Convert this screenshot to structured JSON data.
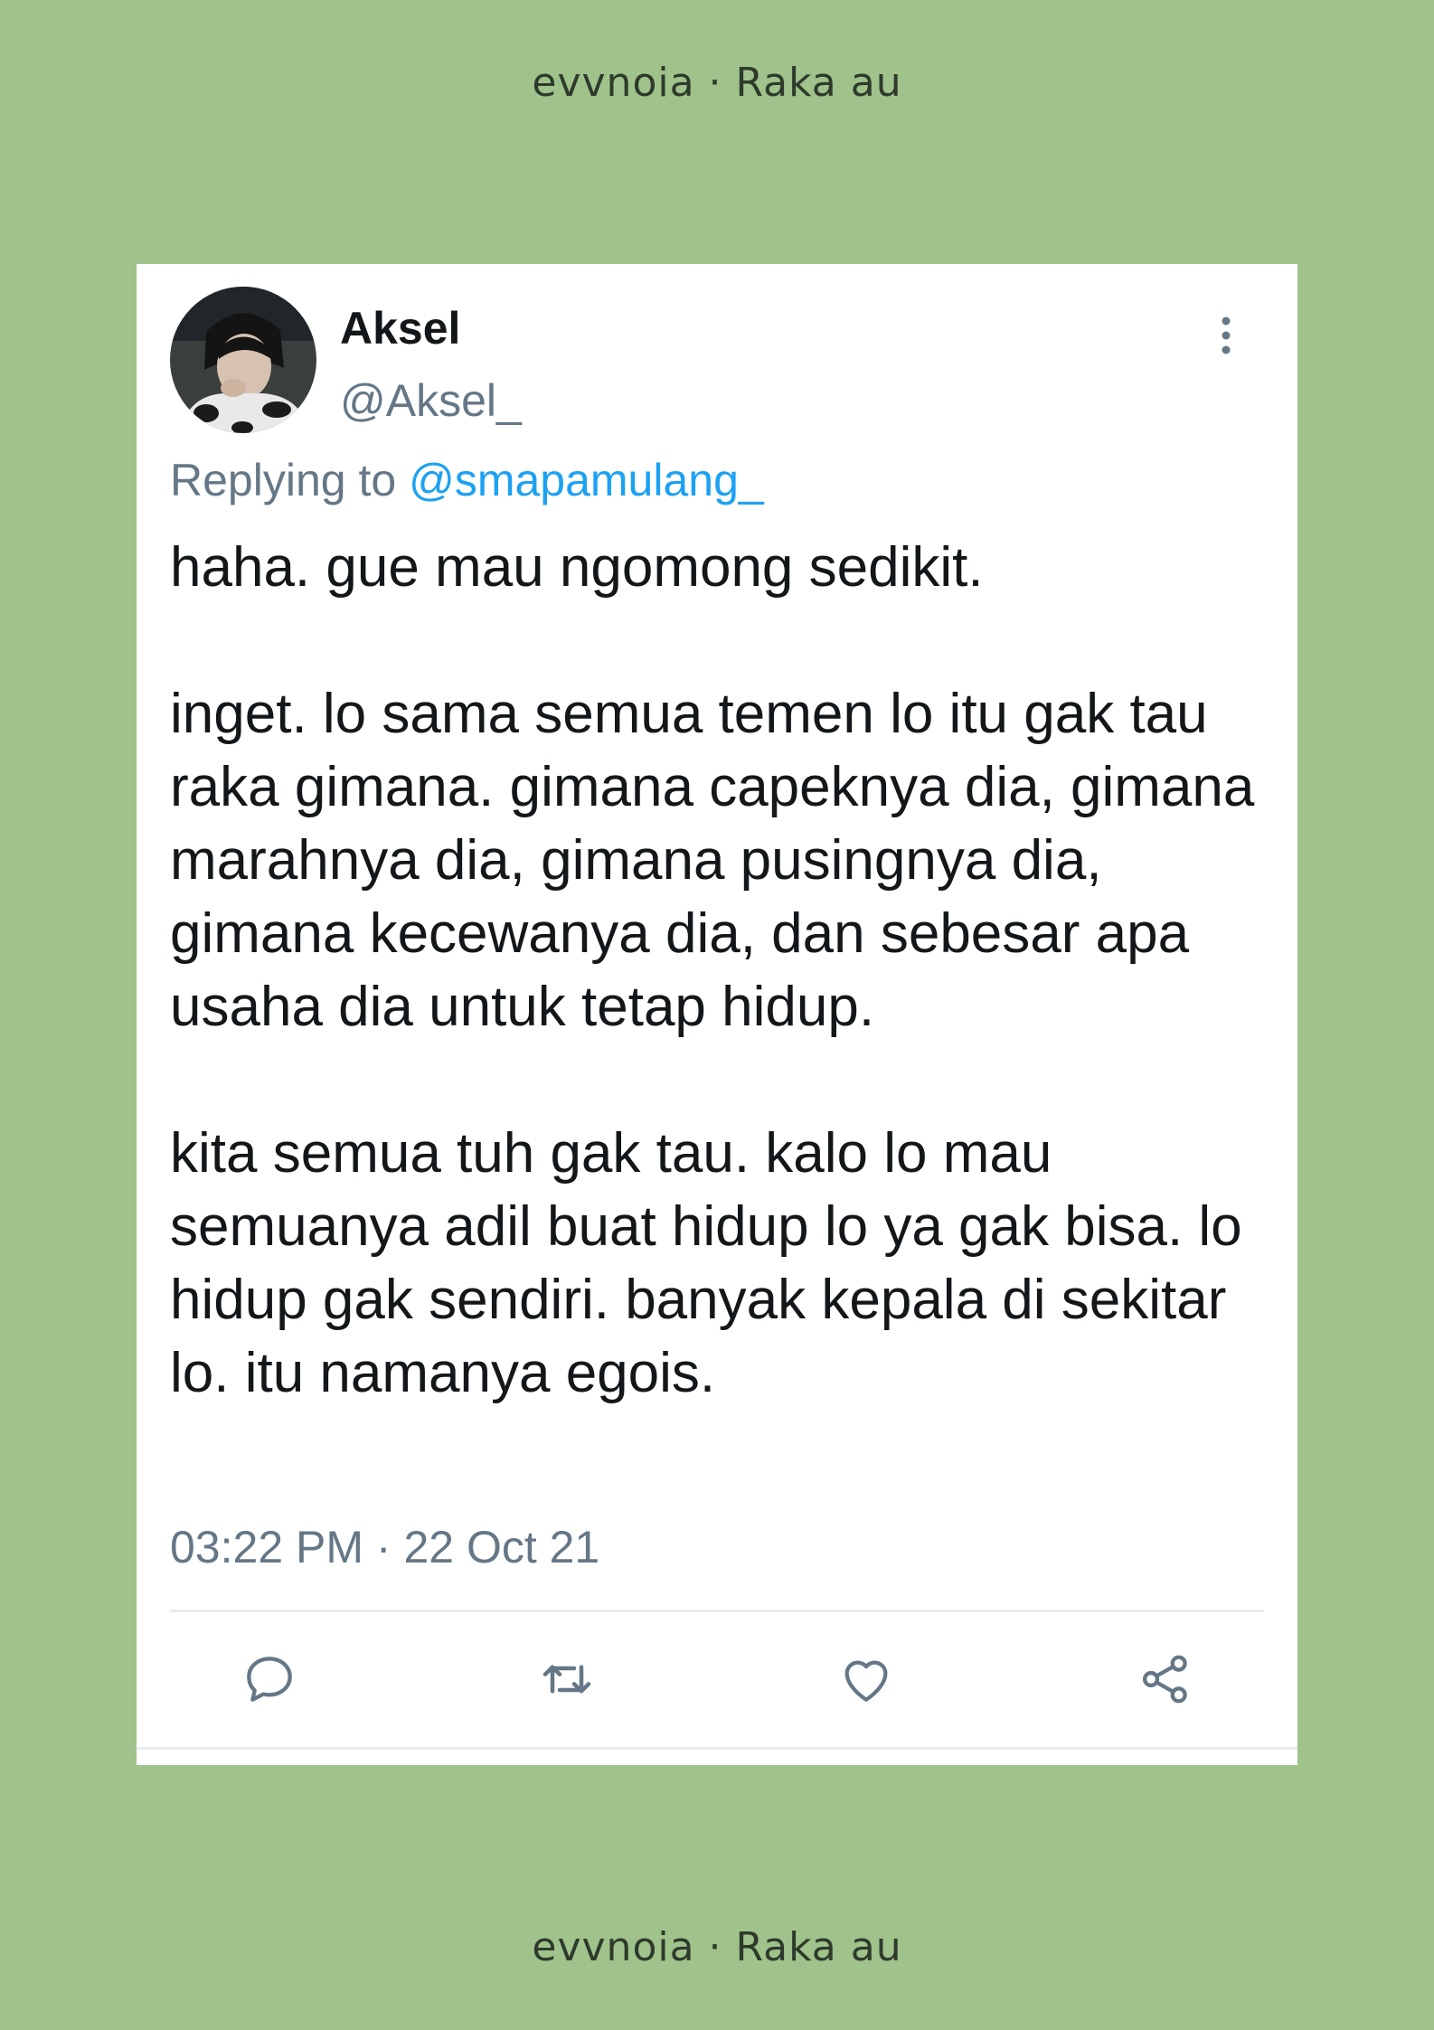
{
  "caption": {
    "top": "evvnoia · Raka au",
    "bottom": "evvnoia · Raka au"
  },
  "tweet": {
    "display_name": "Aksel",
    "handle": "@Aksel_",
    "replying_to_label": "Replying to",
    "replying_to_handle": "@smapamulang_",
    "paragraphs": [
      "haha. gue mau ngomong sedikit.",
      "inget. lo sama semua temen lo itu gak tau raka gimana. gimana capeknya dia, gimana marahnya dia, gimana pusingnya dia, gimana kecewanya dia, dan sebesar apa usaha dia untuk tetap hidup.",
      "kita semua tuh gak tau. kalo lo mau semuanya adil buat hidup lo ya gak bisa. lo hidup gak sendiri. banyak kepala di sekitar lo. itu namanya egois."
    ],
    "timestamp": "03:22 PM · 22 Oct 21"
  },
  "actions": [
    {
      "name": "reply",
      "icon": "comment-icon"
    },
    {
      "name": "retweet",
      "icon": "retweet-icon"
    },
    {
      "name": "like",
      "icon": "heart-icon"
    },
    {
      "name": "share",
      "icon": "share-icon"
    }
  ],
  "colors": {
    "background": "#a0c28b",
    "card": "#ffffff",
    "text": "#14171a",
    "secondary": "#657786",
    "mention": "#1da1f2"
  }
}
